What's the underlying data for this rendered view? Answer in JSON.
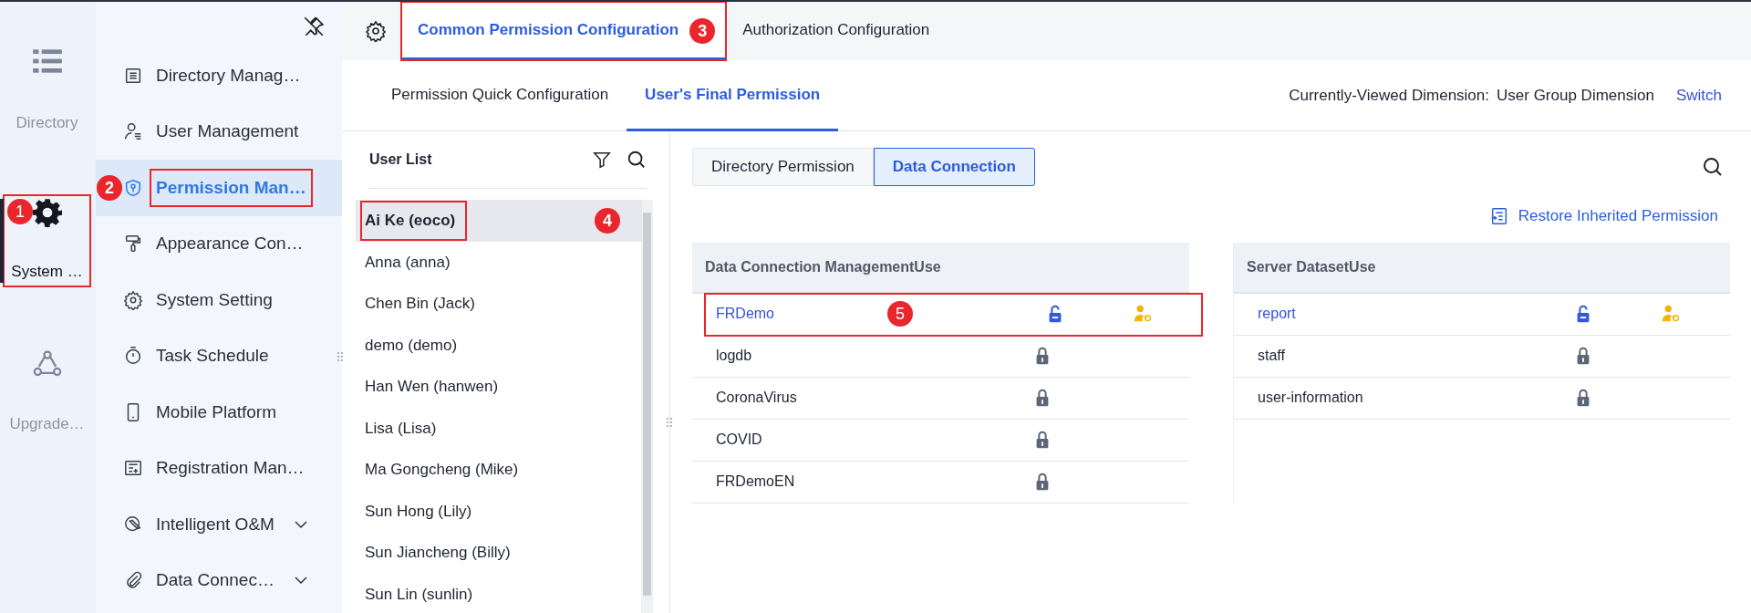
{
  "rail": [
    {
      "label": "Directory",
      "selected": false,
      "highlighted": false
    },
    {
      "label": "System …",
      "selected": true,
      "highlighted": true,
      "marker": "1"
    },
    {
      "label": "Upgrade…",
      "selected": false,
      "highlighted": false
    }
  ],
  "menu": [
    {
      "label": "Directory Manag…",
      "selected": false,
      "highlighted": false,
      "expandable": false
    },
    {
      "label": "User Management",
      "selected": false,
      "highlighted": false,
      "expandable": false
    },
    {
      "label": "Permission Man…",
      "selected": true,
      "highlighted": true,
      "marker": "2",
      "expandable": false
    },
    {
      "label": "Appearance Con…",
      "selected": false,
      "highlighted": false,
      "expandable": false
    },
    {
      "label": "System Setting",
      "selected": false,
      "highlighted": false,
      "expandable": false
    },
    {
      "label": "Task Schedule",
      "selected": false,
      "highlighted": false,
      "expandable": false
    },
    {
      "label": "Mobile Platform",
      "selected": false,
      "highlighted": false,
      "expandable": false
    },
    {
      "label": "Registration Man…",
      "selected": false,
      "highlighted": false,
      "expandable": false
    },
    {
      "label": "Intelligent O&M",
      "selected": false,
      "highlighted": false,
      "expandable": true
    },
    {
      "label": "Data Connec…",
      "selected": false,
      "highlighted": false,
      "expandable": true
    }
  ],
  "tabs": [
    {
      "label": "Common Permission Configuration",
      "selected": true,
      "highlighted": true,
      "marker": "3"
    },
    {
      "label": "Authorization Configuration",
      "selected": false,
      "highlighted": false
    }
  ],
  "subtabs": [
    {
      "label": "Permission Quick Configuration",
      "selected": false
    },
    {
      "label": "User's Final Permission",
      "selected": true
    }
  ],
  "dimension": {
    "label": "Currently-Viewed Dimension:",
    "value": "User Group Dimension",
    "action": "Switch"
  },
  "user_list": {
    "title": "User List",
    "users": [
      {
        "name": "Ai Ke (eoco)",
        "selected": true,
        "highlighted": true,
        "marker": "4"
      },
      {
        "name": "Anna (anna)",
        "selected": false,
        "highlighted": false
      },
      {
        "name": "Chen Bin (Jack)",
        "selected": false,
        "highlighted": false
      },
      {
        "name": "demo (demo)",
        "selected": false,
        "highlighted": false
      },
      {
        "name": "Han Wen (hanwen)",
        "selected": false,
        "highlighted": false
      },
      {
        "name": "Lisa (Lisa)",
        "selected": false,
        "highlighted": false
      },
      {
        "name": "Ma Gongcheng (Mike)",
        "selected": false,
        "highlighted": false
      },
      {
        "name": "Sun Hong (Lily)",
        "selected": false,
        "highlighted": false
      },
      {
        "name": "Sun Jiancheng (Billy)",
        "selected": false,
        "highlighted": false
      },
      {
        "name": "Sun Lin (sunlin)",
        "selected": false,
        "highlighted": false
      }
    ]
  },
  "segments": [
    {
      "label": "Directory Permission",
      "selected": false
    },
    {
      "label": "Data Connection",
      "selected": true
    }
  ],
  "restore_link": "Restore Inherited Permission",
  "tables": [
    {
      "columns": [
        "Data Connection Management",
        "Use"
      ],
      "rows": [
        {
          "name": "FRDemo",
          "linked": true,
          "locked": false,
          "inherited": true,
          "highlighted": true,
          "marker": "5"
        },
        {
          "name": "logdb",
          "linked": false,
          "locked": true,
          "inherited": false,
          "highlighted": false
        },
        {
          "name": "CoronaVirus",
          "linked": false,
          "locked": true,
          "inherited": false,
          "highlighted": false
        },
        {
          "name": "COVID",
          "linked": false,
          "locked": true,
          "inherited": false,
          "highlighted": false
        },
        {
          "name": "FRDemoEN",
          "linked": false,
          "locked": true,
          "inherited": false,
          "highlighted": false
        }
      ]
    },
    {
      "columns": [
        "Server Dataset",
        "Use"
      ],
      "rows": [
        {
          "name": "report",
          "linked": true,
          "locked": false,
          "inherited": true,
          "highlighted": false
        },
        {
          "name": "staff",
          "linked": false,
          "locked": true,
          "inherited": false,
          "highlighted": false
        },
        {
          "name": "user-information",
          "linked": false,
          "locked": true,
          "inherited": false,
          "highlighted": false
        }
      ]
    }
  ]
}
